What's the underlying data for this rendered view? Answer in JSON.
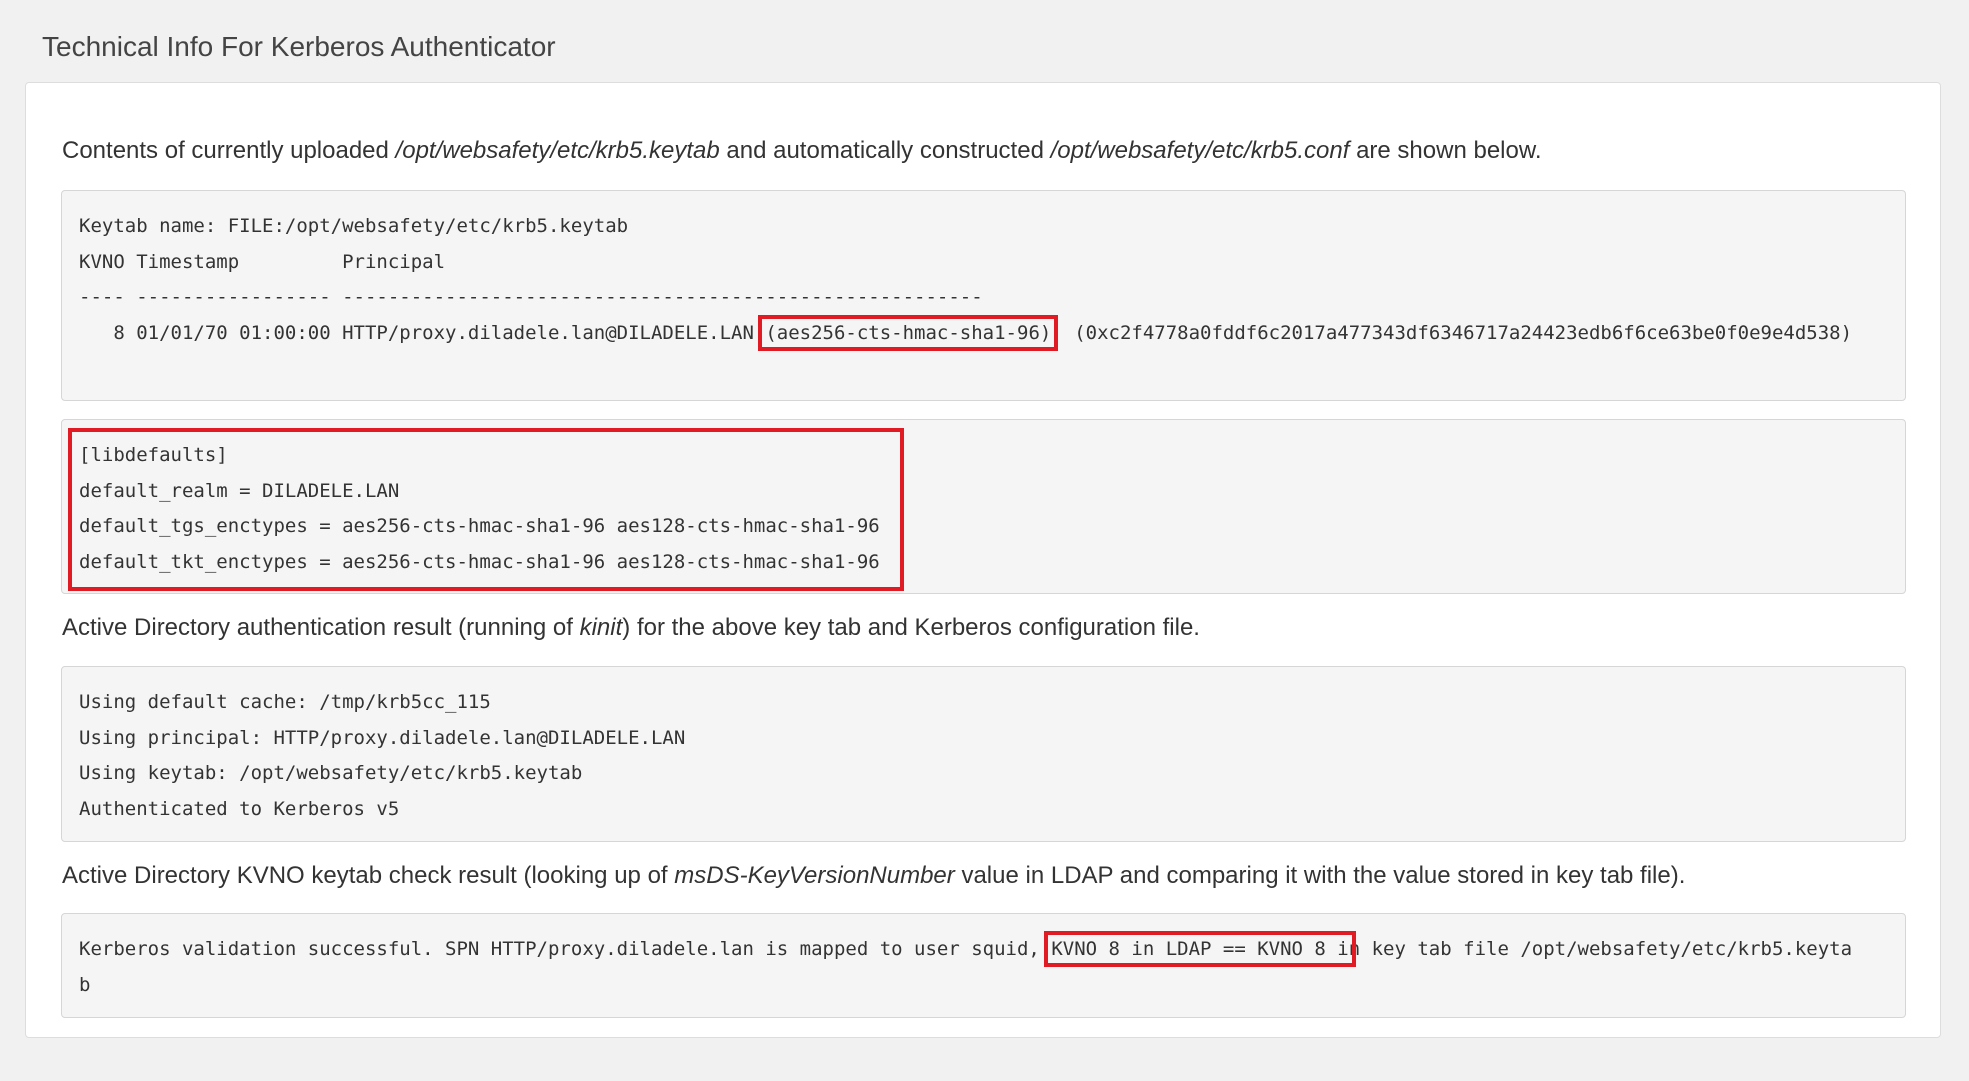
{
  "page": {
    "title": "Technical Info For Kerberos Authenticator"
  },
  "intro": {
    "prefix": "Contents of currently uploaded ",
    "keytab_path": "/opt/websafety/etc/krb5.keytab",
    "middle": " and automatically constructed ",
    "conf_path": "/opt/websafety/etc/krb5.conf",
    "suffix": " are shown below."
  },
  "keytab_block": {
    "line1": "Keytab name: FILE:/opt/websafety/etc/krb5.keytab",
    "line2": "KVNO Timestamp         Principal",
    "line3": "---- ----------------- --------------------------------------------------------",
    "entry_prefix": "   8 01/01/70 01:00:00 HTTP/proxy.diladele.lan@DILADELE.LAN ",
    "entry_enctype": "(aes256-cts-hmac-sha1-96)",
    "entry_suffix": "  (0xc2f4778a0fddf6c2017a477343df6346717a24423edb6f6ce63be0f0e9e4d538)"
  },
  "conf_block": {
    "lines": [
      "[libdefaults]",
      "default_realm = DILADELE.LAN",
      "default_tgs_enctypes = aes256-cts-hmac-sha1-96 aes128-cts-hmac-sha1-96",
      "default_tkt_enctypes = aes256-cts-hmac-sha1-96 aes128-cts-hmac-sha1-96"
    ]
  },
  "auth_intro": {
    "prefix": "Active Directory authentication result (running of ",
    "cmd": "kinit",
    "suffix": ") for the above key tab and Kerberos configuration file."
  },
  "auth_block": {
    "lines": [
      "Using default cache: /tmp/krb5cc_115",
      "Using principal: HTTP/proxy.diladele.lan@DILADELE.LAN",
      "Using keytab: /opt/websafety/etc/krb5.keytab",
      "Authenticated to Kerberos v5"
    ]
  },
  "kvno_intro": {
    "prefix": "Active Directory KVNO keytab check result (looking up of ",
    "attr": "msDS-KeyVersionNumber",
    "suffix": " value in LDAP and comparing it with the value stored in key tab file)."
  },
  "kvno_block": {
    "prefix": "Kerberos validation successful. SPN HTTP/proxy.diladele.lan is mapped to user squid, ",
    "highlight": "KVNO 8 in LDAP == KVNO 8 i",
    "suffix": "n key tab file /opt/websafety/etc/krb5.keyta",
    "line2": "b"
  },
  "colors": {
    "background": "#f1f1f1",
    "panel": "#ffffff",
    "code_background": "#f5f5f5",
    "highlight": "#e01b24"
  }
}
